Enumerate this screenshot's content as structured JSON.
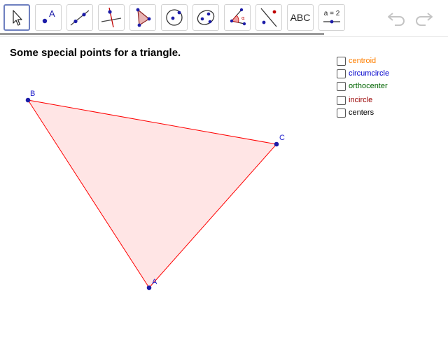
{
  "toolbar": {
    "tools": [
      {
        "name": "move-tool",
        "icon": "arrow-pointer-icon",
        "selected": true
      },
      {
        "name": "point-tool",
        "icon": "point-a-icon",
        "glyph": "A"
      },
      {
        "name": "line-tool",
        "icon": "line-through-points-icon"
      },
      {
        "name": "perpendicular-line-tool",
        "icon": "perpendicular-line-icon"
      },
      {
        "name": "polygon-tool",
        "icon": "polygon-icon"
      },
      {
        "name": "circle-tool",
        "icon": "circle-center-point-icon"
      },
      {
        "name": "conic-tool",
        "icon": "ellipse-icon"
      },
      {
        "name": "angle-tool",
        "icon": "angle-icon",
        "glyph": "α"
      },
      {
        "name": "reflect-tool",
        "icon": "reflect-line-icon"
      },
      {
        "name": "text-tool",
        "icon": "text-icon",
        "label": "ABC"
      },
      {
        "name": "slider-tool",
        "icon": "slider-icon",
        "label": "a = 2"
      }
    ],
    "undo_icon": "undo-icon",
    "redo_icon": "redo-icon"
  },
  "heading": "Some special points for a triangle.",
  "triangle": {
    "points": [
      {
        "label": "A"
      },
      {
        "label": "B"
      },
      {
        "label": "C"
      }
    ],
    "fill_color": "#ffe5e5",
    "stroke_color": "#ff0000",
    "point_color": "#1c1ca8"
  },
  "checkboxes": [
    {
      "label": "centroid",
      "color": "#ff7f00",
      "checked": false
    },
    {
      "label": "circumcircle",
      "color": "#0000cc",
      "checked": false
    },
    {
      "label": "orthocenter",
      "color": "#006400",
      "checked": false
    },
    {
      "label": "incircle",
      "color": "#990000",
      "checked": false
    },
    {
      "label": "centers",
      "color": "#000000",
      "checked": false
    }
  ]
}
